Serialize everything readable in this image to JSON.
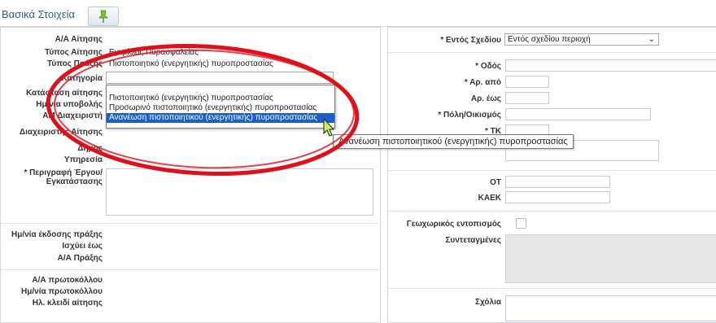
{
  "section": {
    "title": "Βασικά Στοιχεία",
    "action_icon": "pin-icon"
  },
  "left": {
    "labels": {
      "aa_aitisis": "Α/Α Αίτησης",
      "typos_aitisis": "Τύπος Αίτησης",
      "typos_praxis": "Τύπος Πράξης",
      "kategoria": "Κατηγορία",
      "katastasi": "Κατάσταση αίτησης",
      "hmnia_ypovolis": "Ημ/νία υποβολής",
      "am_diaxeiristi": "ΑΜ Διαχειριστή",
      "diaxeiristis": "Διαχειριστής Αίτησης",
      "dimos": "Δήμος",
      "ypiresia": "Υπηρεσία",
      "perigrafi": "* Περιγραφή Έργου/ Εγκατάστασης",
      "hmnia_ekdosis": "Ημ/νία έκδοσης πράξης",
      "isxyei_eos": "Ισχύει έως",
      "aa_praxis": "Α/Α Πράξης",
      "aa_protokollou": "Α/Α πρωτοκόλλου",
      "hmnia_protokollou": "Ημ/νία πρωτοκόλλου",
      "hl_kleidi": "Ηλ. κλειδί αίτησης"
    },
    "values": {
      "typos_aitisis": "Εγκρίσεις Πυρασφαλείας",
      "typos_praxis": "Πιστοποιητικό (ενεργητικής) πυροπροστασίας"
    }
  },
  "dropdown": {
    "options": [
      "Πιστοποιητικό (ενεργητικής) πυροπροστασίας",
      "Προσωρινό πιστοποιητικό (ενεργητικής) πυροπροστασίας",
      "Ανανέωση πιστοποιητικού (ενεργητικής) πυροπροστασίας"
    ],
    "highlighted_index": 2,
    "tooltip": "Ανανέωση πιστοποιητικού (ενεργητικής) πυροπροστασίας"
  },
  "right": {
    "labels": {
      "entos_sxediou": "* Εντός Σχεδίου",
      "odos": "* Οδός",
      "ar_apo": "* Αρ. από",
      "ar_eos": "Αρ. έως",
      "poli": "* Πόλη/Οικισμός",
      "tk": "* ΤΚ",
      "ot": "ΟΤ",
      "kaek": "ΚΑΕΚ",
      "geoxoriko": "Γεωχωρικός εντοπισμός",
      "syntetagmenes": "Συντεταγμένες",
      "sxolia": "Σχόλια"
    },
    "entos_sxediou_value": "Εντός σχεδίου περιοχή"
  },
  "colors": {
    "accent": "#2a5d9f",
    "highlight": "#1b5fce",
    "annotation": "#e0101a"
  }
}
